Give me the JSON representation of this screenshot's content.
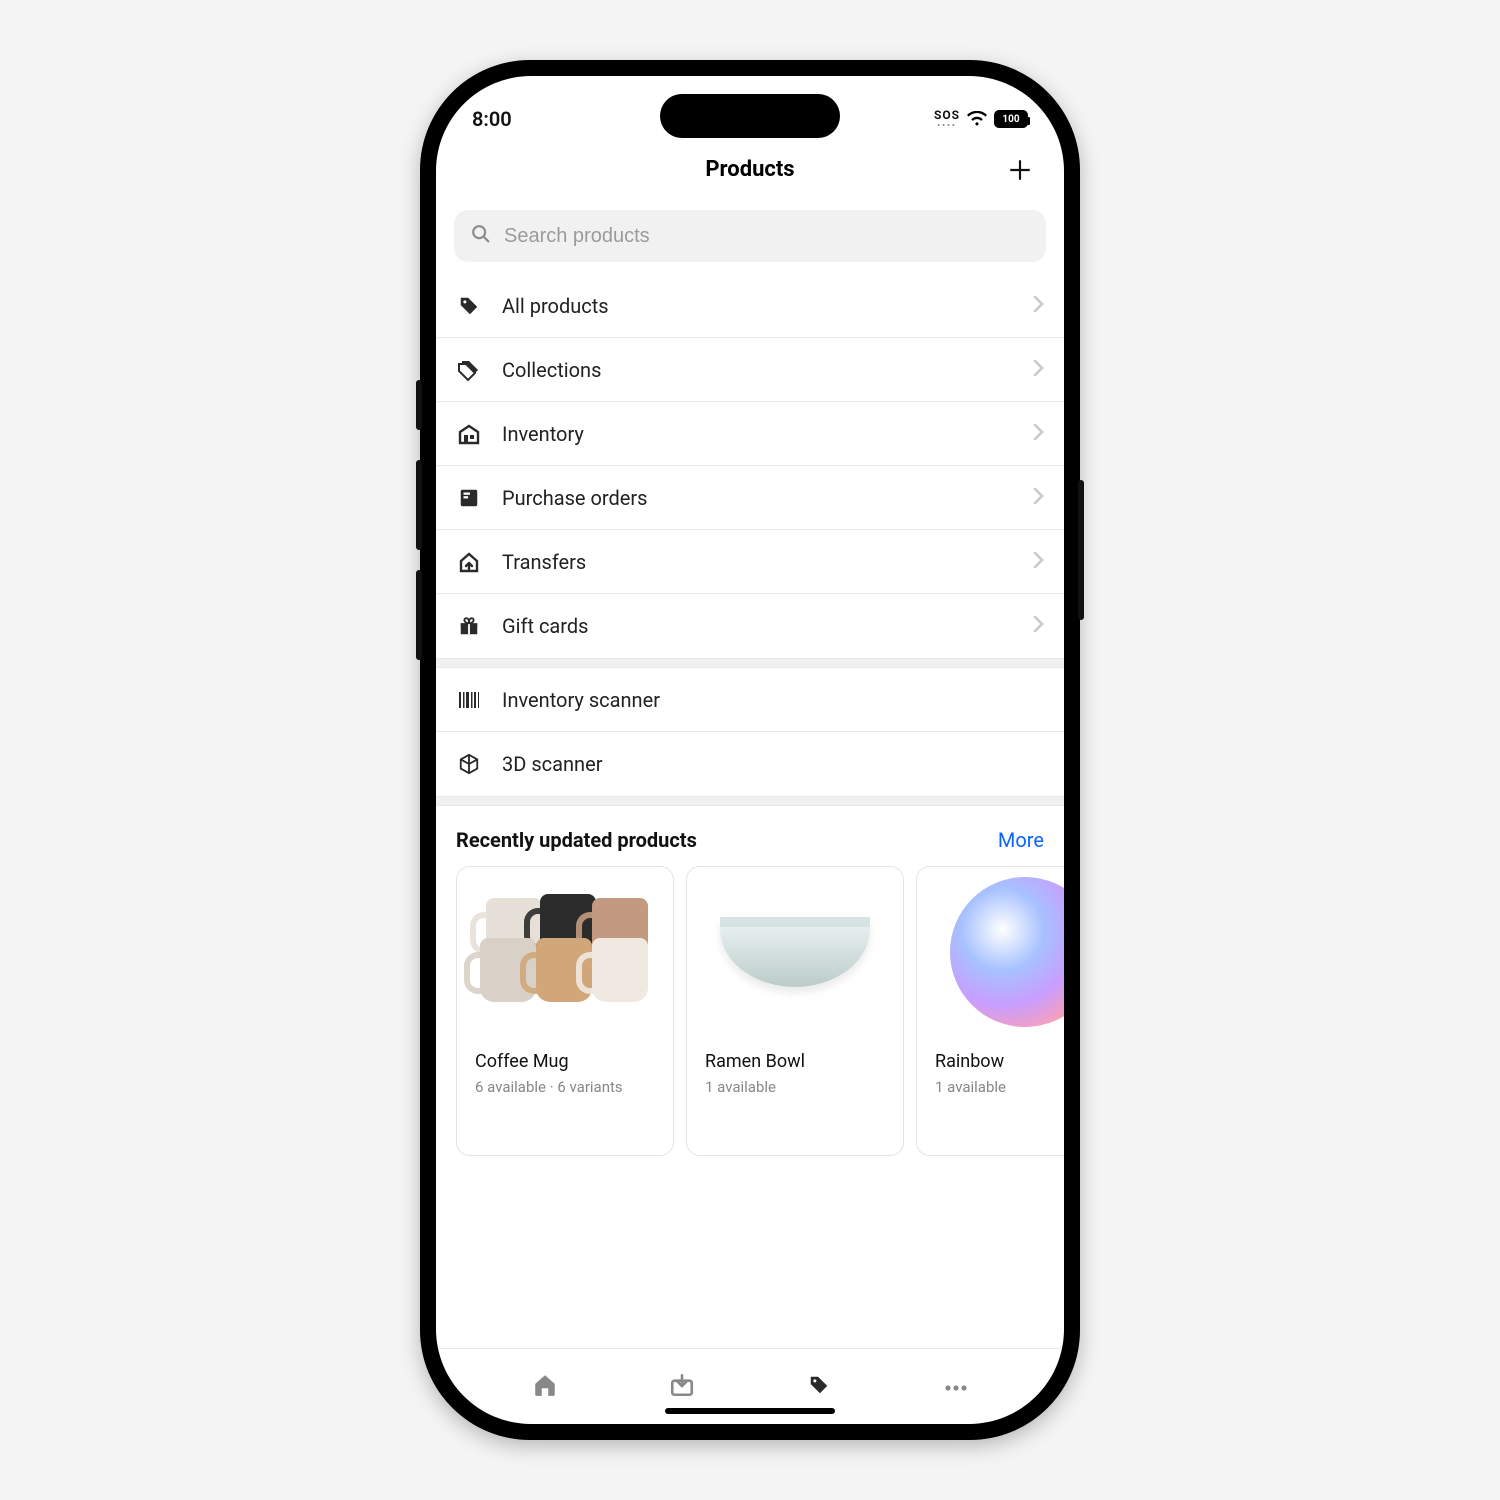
{
  "status_bar": {
    "time": "8:00",
    "sos": "SOS",
    "battery": "100"
  },
  "header": {
    "title": "Products"
  },
  "search": {
    "placeholder": "Search products"
  },
  "menu_group_1": [
    {
      "key": "all-products",
      "label": "All products",
      "icon": "tag"
    },
    {
      "key": "collections",
      "label": "Collections",
      "icon": "tags-stack"
    },
    {
      "key": "inventory",
      "label": "Inventory",
      "icon": "warehouse"
    },
    {
      "key": "purchase-orders",
      "label": "Purchase orders",
      "icon": "file-box"
    },
    {
      "key": "transfers",
      "label": "Transfers",
      "icon": "house-arrow"
    },
    {
      "key": "gift-cards",
      "label": "Gift cards",
      "icon": "gift"
    }
  ],
  "menu_group_2": [
    {
      "key": "inventory-scanner",
      "label": "Inventory scanner",
      "icon": "barcode"
    },
    {
      "key": "3d-scanner",
      "label": "3D scanner",
      "icon": "cube"
    }
  ],
  "recent": {
    "title": "Recently updated products",
    "more_label": "More",
    "items": [
      {
        "name": "Coffee Mug",
        "meta": "6 available · 6 variants"
      },
      {
        "name": "Ramen Bowl",
        "meta": "1 available"
      },
      {
        "name": "Rainbow",
        "meta": "1 available"
      }
    ]
  },
  "tabs": [
    {
      "key": "home",
      "icon": "home",
      "active": false
    },
    {
      "key": "inbox",
      "icon": "inbox",
      "active": false
    },
    {
      "key": "products",
      "icon": "tag",
      "active": true
    },
    {
      "key": "more",
      "icon": "more",
      "active": false
    }
  ]
}
